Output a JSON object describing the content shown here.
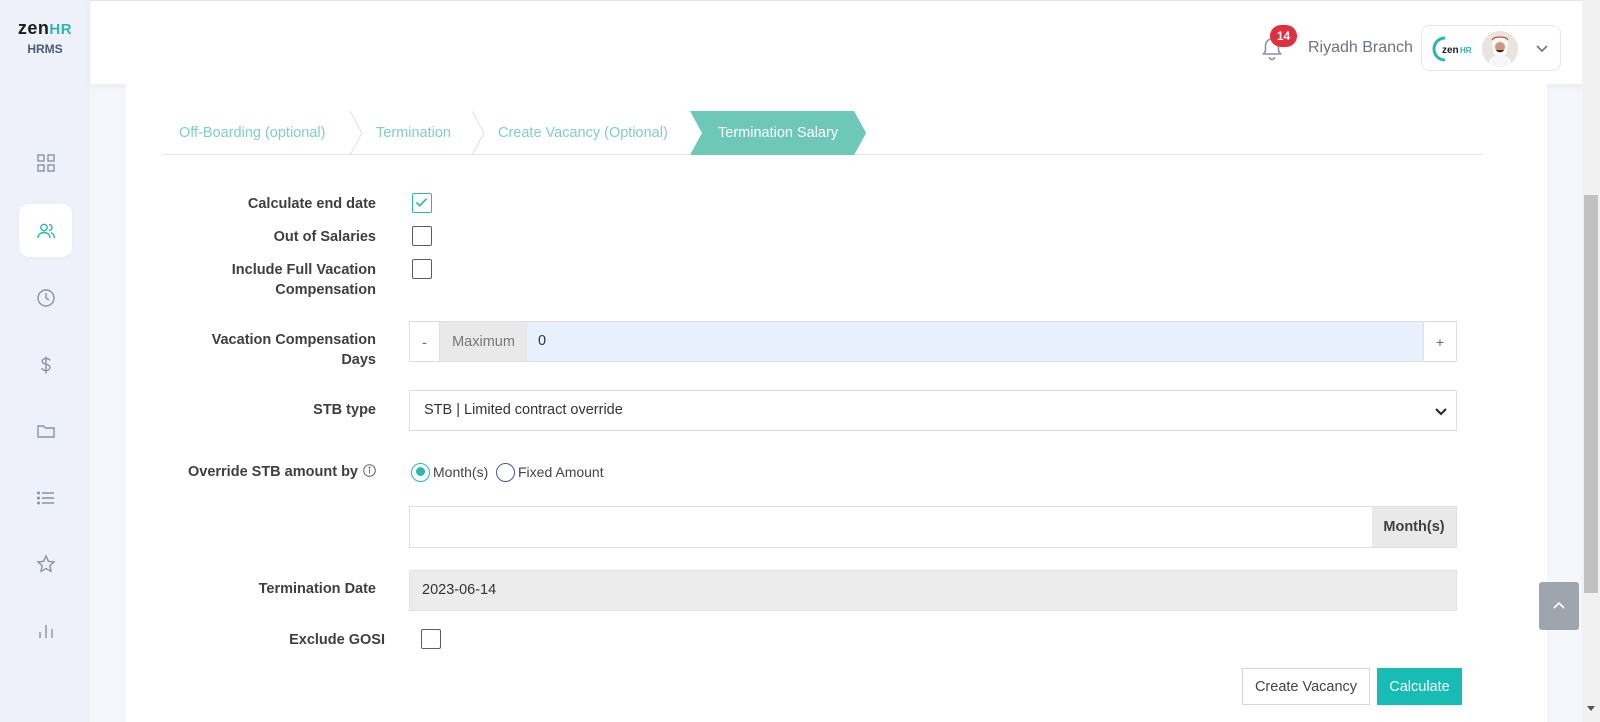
{
  "brand": {
    "logo_main": "zen",
    "logo_accent": "HR",
    "subtitle": "HRMS"
  },
  "sidebar": {
    "items": [
      {
        "name": "dashboard",
        "icon": "grid-icon",
        "active": false
      },
      {
        "name": "employees",
        "icon": "users-icon",
        "active": true
      },
      {
        "name": "attendance",
        "icon": "clock-icon",
        "active": false
      },
      {
        "name": "payroll",
        "icon": "dollar-icon",
        "active": false
      },
      {
        "name": "documents",
        "icon": "folder-icon",
        "active": false
      },
      {
        "name": "lists",
        "icon": "list-icon",
        "active": false
      },
      {
        "name": "favorites",
        "icon": "star-icon",
        "active": false
      },
      {
        "name": "reports",
        "icon": "bar-chart-icon",
        "active": false
      }
    ]
  },
  "header": {
    "notification_count": "14",
    "branch": "Riyadh Branch",
    "profile_logo_main": "zen",
    "profile_logo_accent": "HR"
  },
  "steps": [
    {
      "label": "Off-Boarding (optional)",
      "active": false
    },
    {
      "label": "Termination",
      "active": false
    },
    {
      "label": "Create Vacancy (Optional)",
      "active": false
    },
    {
      "label": "Termination Salary",
      "active": true
    }
  ],
  "form": {
    "calculate_end_date": {
      "label": "Calculate end date",
      "checked": true
    },
    "out_of_salaries": {
      "label": "Out of Salaries",
      "checked": false
    },
    "include_full_vacation_line1": "Include Full Vacation",
    "include_full_vacation_line2": "Compensation",
    "include_full_vacation_checked": false,
    "vacation_days_line1": "Vacation Compensation",
    "vacation_days_line2": "Days",
    "vacation_days": {
      "minus": "-",
      "maximum_label": "Maximum",
      "value": "0",
      "plus": "+"
    },
    "stb_type": {
      "label": "STB type",
      "selected": "STB | Limited contract override"
    },
    "override": {
      "label": "Override STB amount by",
      "options": [
        {
          "label": "Month(s)",
          "selected": true
        },
        {
          "label": "Fixed Amount",
          "selected": false
        }
      ],
      "amount_value": "",
      "unit": "Month(s)"
    },
    "termination_date": {
      "label": "Termination Date",
      "value": "2023-06-14"
    },
    "exclude_gosi": {
      "label": "Exclude GOSI",
      "checked": false
    }
  },
  "actions": {
    "create_vacancy": "Create Vacancy",
    "calculate": "Calculate"
  },
  "colors": {
    "accent": "#2bb7b0",
    "primary_button": "#17bcb4",
    "active_step": "#6ec8b7",
    "badge": "#e03040",
    "sidebar_bg": "#eef1fa"
  }
}
